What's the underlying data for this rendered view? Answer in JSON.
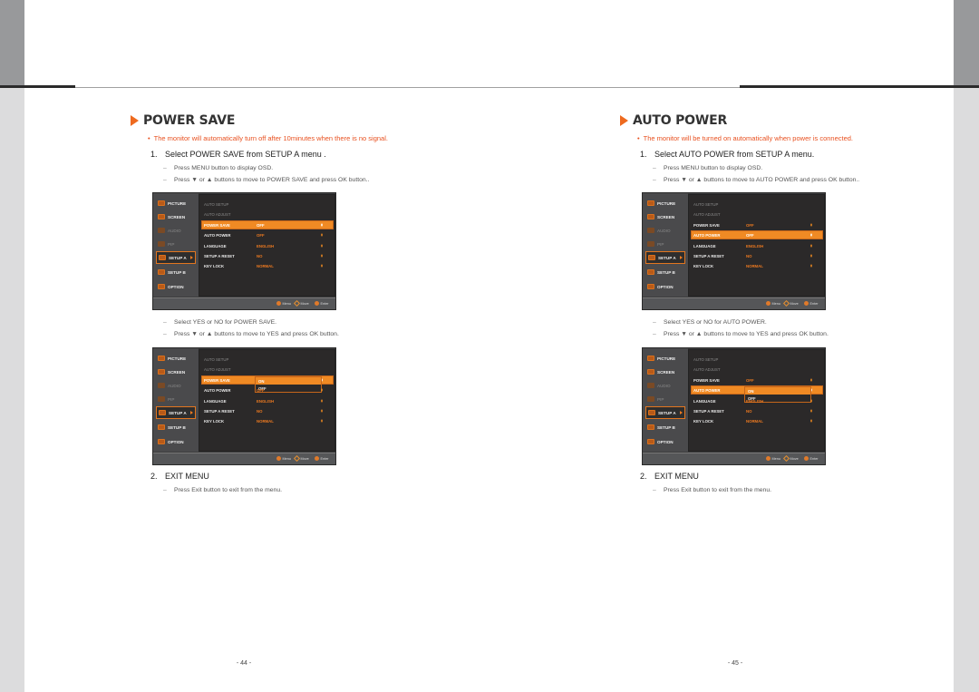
{
  "pages": [
    {
      "number": "- 44 -",
      "title": "POWER SAVE",
      "note": "The monitor will automatically turn off after 10minutes when there is no signal.",
      "step1": {
        "num": "1.",
        "text": "Select POWER SAVE from SETUP A menu .",
        "subs": [
          "Press MENU button to display OSD.",
          "Press ▼ or ▲ buttons to move to POWER SAVE and press OK button.."
        ]
      },
      "step1b": {
        "subs": [
          "Select YES or NO for POWER SAVE.",
          "Press ▼ or ▲ buttons to move to YES and press OK button."
        ]
      },
      "step2": {
        "num": "2.",
        "text": "EXIT MENU",
        "subs": [
          "Press Exit button to exit from the menu."
        ]
      },
      "osd1": {
        "selected_row": "POWER SAVE",
        "dropdown": null
      },
      "osd2": {
        "selected_row": "POWER SAVE",
        "dropdown": [
          "ON",
          "OFF"
        ],
        "dropdown_selected": "ON"
      }
    },
    {
      "number": "- 45 -",
      "title": "AUTO POWER",
      "note": "The monitor will be turned on automatically when power is connected.",
      "step1": {
        "num": "1.",
        "text": "Select AUTO POWER from SETUP A menu.",
        "subs": [
          "Press MENU button to display OSD.",
          "Press ▼ or ▲ buttons to move to AUTO POWER and press OK button.."
        ]
      },
      "step1b": {
        "subs": [
          "Select YES or NO for AUTO POWER.",
          "Press ▼ or ▲ buttons to move to YES and press OK button."
        ]
      },
      "step2": {
        "num": "2.",
        "text": "EXIT MENU",
        "subs": [
          "Press Exit button to exit from the menu."
        ]
      },
      "osd1": {
        "selected_row": "AUTO POWER",
        "dropdown": null
      },
      "osd2": {
        "selected_row": "AUTO POWER",
        "dropdown": [
          "ON",
          "OFF"
        ],
        "dropdown_selected": "ON"
      }
    }
  ],
  "osd": {
    "sidebar": [
      {
        "label": "PICTURE",
        "icon": "picture-icon",
        "dim": false
      },
      {
        "label": "SCREEN",
        "icon": "screen-icon",
        "dim": false
      },
      {
        "label": "AUDIO",
        "icon": "audio-icon",
        "dim": true
      },
      {
        "label": "PIP",
        "icon": "pip-icon",
        "dim": true
      },
      {
        "label": "SETUP A",
        "icon": "setup-icon",
        "dim": false,
        "active": true
      },
      {
        "label": "SETUP B",
        "icon": "setup-icon",
        "dim": false
      },
      {
        "label": "OPTION",
        "icon": "option-icon",
        "dim": false
      }
    ],
    "rows": [
      {
        "label": "AUTO SETUP",
        "value": "",
        "dim": true
      },
      {
        "label": "AUTO ADJUST",
        "value": "",
        "dim": true
      },
      {
        "label": "POWER SAVE",
        "value": "OFF"
      },
      {
        "label": "AUTO POWER",
        "value": "OFF"
      },
      {
        "label": "LANGUAGE",
        "value": "ENGLISH"
      },
      {
        "label": "SETUP A RESET",
        "value": "NO"
      },
      {
        "label": "KEY LOCK",
        "value": "NORMAL"
      }
    ],
    "footer": [
      {
        "label": "Menu",
        "icon": "menu-button-icon"
      },
      {
        "label": "Move",
        "icon": "move-icon"
      },
      {
        "label": "Enter",
        "icon": "enter-icon"
      }
    ],
    "colors": {
      "accent": "#f08a24",
      "panel": "#2b2929",
      "sidebar": "#4a4a4c"
    }
  },
  "colors": {
    "note": "#e8501f",
    "title_triangle": "#ee6a1f"
  }
}
